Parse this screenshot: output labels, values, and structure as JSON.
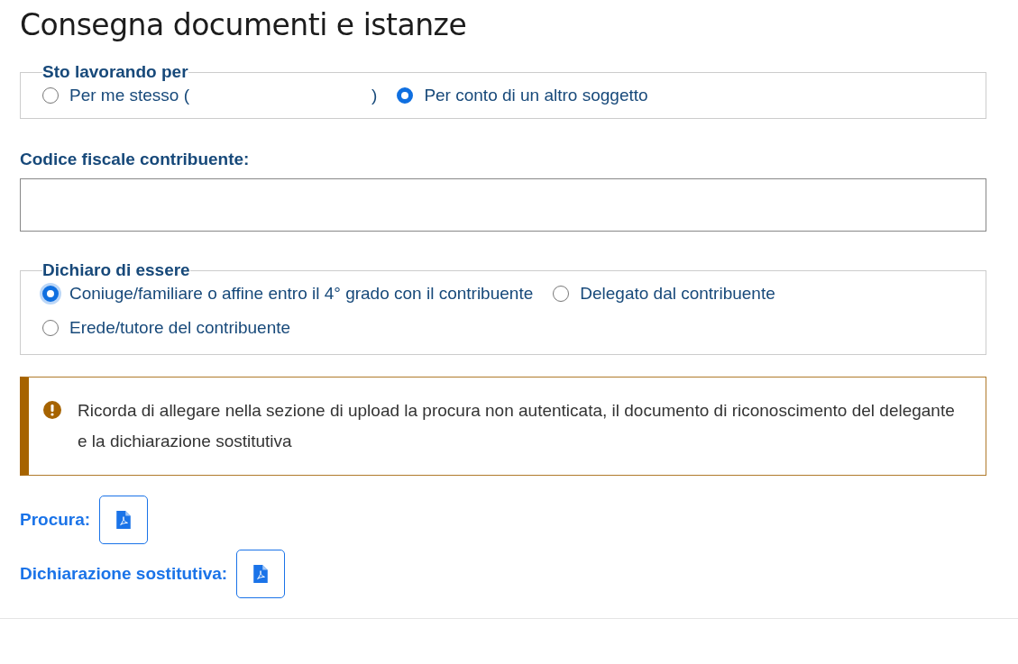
{
  "title": "Consegna documenti e istanze",
  "working_for": {
    "legend": "Sto lavorando per",
    "options": [
      {
        "label": "Per me stesso (",
        "suffix": ")",
        "selected": false
      },
      {
        "label": "Per conto di un altro soggetto",
        "selected": true
      }
    ]
  },
  "tax_code": {
    "label": "Codice fiscale contribuente:"
  },
  "declaration": {
    "legend": "Dichiaro di essere",
    "options": [
      {
        "label": "Coniuge/familiare o affine entro il 4° grado con il contribuente",
        "selected": true
      },
      {
        "label": "Delegato dal contribuente",
        "selected": false
      },
      {
        "label": "Erede/tutore del contribuente",
        "selected": false
      }
    ]
  },
  "alert": {
    "text": "Ricorda di allegare nella sezione di upload la procura non autenticata, il documento di riconoscimento del delegante e la dichiarazione sostitutiva"
  },
  "attachments": [
    {
      "label": "Procura:"
    },
    {
      "label": "Dichiarazione sostitutiva:"
    }
  ]
}
